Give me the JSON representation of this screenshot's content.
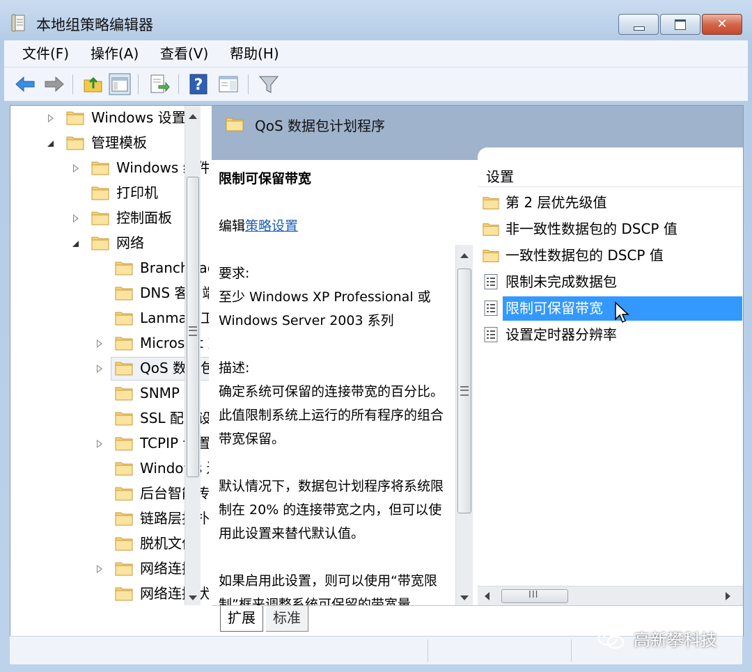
{
  "window": {
    "title": "本地组策略编辑器"
  },
  "menu": [
    "文件(F)",
    "操作(A)",
    "查看(V)",
    "帮助(H)"
  ],
  "toolbar": {
    "icons": [
      "back-arrow-icon",
      "forward-arrow-icon",
      "up-folder-icon",
      "show-hide-tree-icon",
      "export-list-icon",
      "help-icon",
      "extended-view-icon",
      "filter-icon"
    ]
  },
  "tree": {
    "items": [
      {
        "label": "Windows 设置",
        "state": "collapsed"
      },
      {
        "label": "管理模板",
        "state": "expanded"
      },
      {
        "label": "Windows 组件",
        "state": "collapsed"
      },
      {
        "label": "打印机",
        "state": "none"
      },
      {
        "label": "控制面板",
        "state": "collapsed"
      },
      {
        "label": "网络",
        "state": "expanded"
      },
      {
        "label": "BranchCache",
        "state": "none"
      },
      {
        "label": "DNS 客户端",
        "state": "none"
      },
      {
        "label": "Lanman 工作站",
        "state": "none"
      },
      {
        "label": "Microsoft 对等网络服务",
        "state": "collapsed"
      },
      {
        "label": "QoS 数据包计划程序",
        "state": "collapsed",
        "selected": true
      },
      {
        "label": "SNMP",
        "state": "none"
      },
      {
        "label": "SSL 配置设置",
        "state": "none"
      },
      {
        "label": "TCPIP 设置",
        "state": "collapsed"
      },
      {
        "label": "Windows 连接管理器",
        "state": "none"
      },
      {
        "label": "后台智能传送服务",
        "state": "none"
      },
      {
        "label": "链路层拓扑发现",
        "state": "none"
      },
      {
        "label": "脱机文件",
        "state": "none"
      },
      {
        "label": "网络连接",
        "state": "collapsed"
      },
      {
        "label": "网络连接状态指示器",
        "state": "none"
      }
    ]
  },
  "header": {
    "title": "QoS 数据包计划程序"
  },
  "description": {
    "heading": "限制可保留带宽",
    "edit_prefix": "编辑",
    "edit_link": "策略设置",
    "req_label": "要求:",
    "req_text": "至少 Windows XP Professional 或 Windows Server 2003 系列",
    "desc_label": "描述:",
    "desc_p1": "确定系统可保留的连接带宽的百分比。此值限制系统上运行的所有程序的组合带宽保留。",
    "desc_p2": "默认情况下，数据包计划程序将系统限制在 20% 的连接带宽之内，但可以使用此设置来替代默认值。",
    "desc_p3": "如果启用此设置，则可以使用“带宽限制”框来调整系统可保留的带宽量。"
  },
  "settings": {
    "column_label": "设置",
    "items": [
      {
        "label": "第 2 层优先级值",
        "type": "folder"
      },
      {
        "label": "非一致性数据包的 DSCP 值",
        "type": "folder"
      },
      {
        "label": "一致性数据包的 DSCP 值",
        "type": "folder"
      },
      {
        "label": "限制未完成数据包",
        "type": "policy"
      },
      {
        "label": "限制可保留带宽",
        "type": "policy",
        "selected": true
      },
      {
        "label": "设置定时器分辨率",
        "type": "policy"
      }
    ]
  },
  "tabs": [
    "扩展",
    "标准"
  ],
  "watermark": "高新攀科技"
}
